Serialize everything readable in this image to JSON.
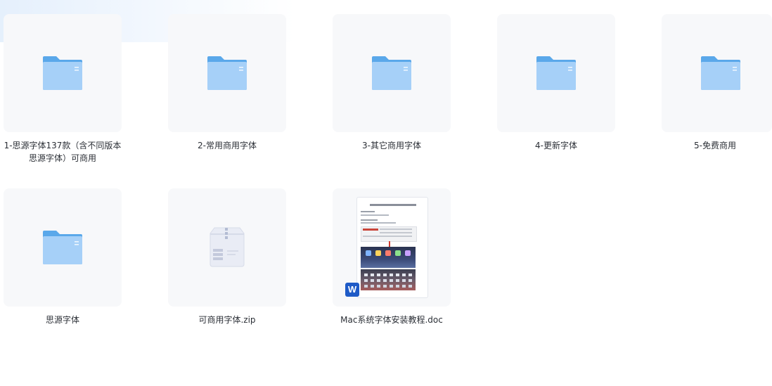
{
  "items": [
    {
      "name": "1-思源字体137款（含不同版本思源字体）可商用",
      "type": "folder"
    },
    {
      "name": "2-常用商用字体",
      "type": "folder"
    },
    {
      "name": "3-其它商用字体",
      "type": "folder"
    },
    {
      "name": "4-更新字体",
      "type": "folder"
    },
    {
      "name": "5-免费商用",
      "type": "folder"
    },
    {
      "name": "思源字体",
      "type": "folder"
    },
    {
      "name": "可商用字体.zip",
      "type": "zip"
    },
    {
      "name": "Mac系统字体安装教程.doc",
      "type": "doc"
    }
  ],
  "colors": {
    "folder_back": "#5aa8ea",
    "folder_front": "#a6d0f8",
    "word_blue": "#1f5bc7"
  }
}
